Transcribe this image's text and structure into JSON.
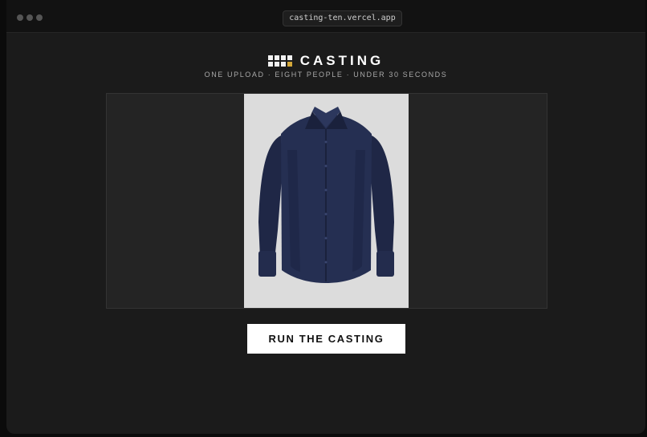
{
  "browser": {
    "url": "casting-ten.vercel.app",
    "window_controls": [
      "close",
      "minimize",
      "maximize"
    ]
  },
  "header": {
    "logo_icon": "grid-logo-icon",
    "title": "CASTING",
    "tagline": "ONE UPLOAD · EIGHT PEOPLE · UNDER 30 SECONDS"
  },
  "stage": {
    "image_subject": "navy-dress-shirt"
  },
  "actions": {
    "run_label": "RUN THE CASTING"
  },
  "colors": {
    "accent": "#d4a83a",
    "background": "#1b1b1b",
    "shirt": "#252f52",
    "photo_bg": "#dcdcdc"
  }
}
